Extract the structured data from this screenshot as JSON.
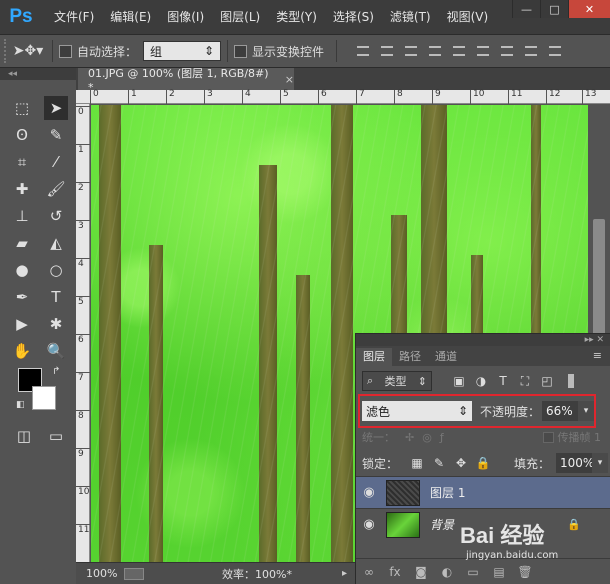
{
  "menubar": {
    "logo": "Ps",
    "items": [
      "文件(F)",
      "编辑(E)",
      "图像(I)",
      "图层(L)",
      "类型(Y)",
      "选择(S)",
      "滤镜(T)",
      "视图(V)"
    ]
  },
  "window": {
    "minimize": "—",
    "maximize": "□",
    "close": "✕"
  },
  "options": {
    "auto_select_label": "自动选择：",
    "auto_select_value": "组",
    "show_transform_label": "显示变换控件"
  },
  "document": {
    "tab_title": "01.JPG @ 100% (图层 1, RGB/8#) *",
    "tab_close": "×"
  },
  "rulers": {
    "top": [
      "0",
      "1",
      "2",
      "3",
      "4",
      "5",
      "6",
      "7",
      "8",
      "9",
      "10",
      "11",
      "12",
      "13"
    ],
    "left": [
      "0",
      "1",
      "2",
      "3",
      "4",
      "5",
      "6",
      "7",
      "8",
      "9",
      "10",
      "11"
    ]
  },
  "status": {
    "zoom": "100%",
    "efficiency": "效率：100%*"
  },
  "layers_panel": {
    "tabs": [
      "图层",
      "路径",
      "通道"
    ],
    "kind_label": "类型",
    "blend_mode": "滤色",
    "opacity_label": "不透明度：",
    "opacity_value": "66%",
    "unify_label": "统一：",
    "propagate_label": "传播帧 1",
    "lock_label": "锁定：",
    "fill_label": "填充：",
    "fill_value": "100%",
    "layers": [
      {
        "name": "图层 1",
        "selected": true
      },
      {
        "name": "背景",
        "selected": false,
        "locked": true
      }
    ]
  },
  "watermark": {
    "text": "Bai 经验",
    "url": "jingyan.baidu.com"
  }
}
